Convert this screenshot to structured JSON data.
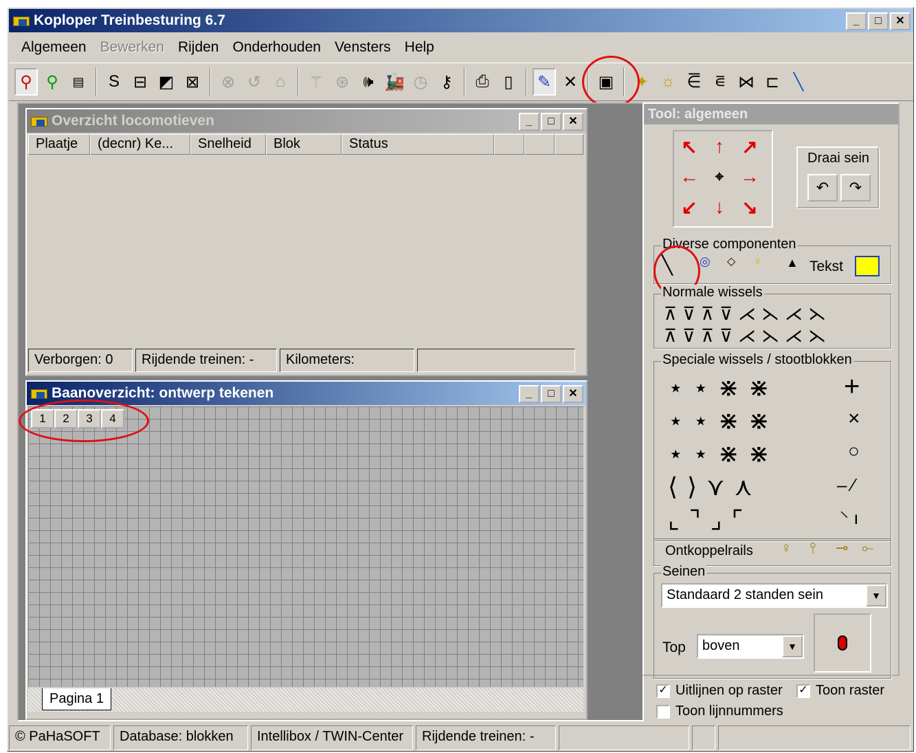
{
  "app": {
    "title": "Koploper Treinbesturing 6.7"
  },
  "menu": [
    {
      "label": "Algemeen",
      "disabled": false
    },
    {
      "label": "Bewerken",
      "disabled": true
    },
    {
      "label": "Rijden",
      "disabled": false
    },
    {
      "label": "Onderhouden",
      "disabled": false
    },
    {
      "label": "Vensters",
      "disabled": false
    },
    {
      "label": "Help",
      "disabled": false
    }
  ],
  "loco_window": {
    "title": "Overzicht locomotieven",
    "columns": [
      "Plaatje",
      "(decnr) Ke...",
      "Snelheid",
      "Blok",
      "Status",
      "",
      "",
      ""
    ],
    "status": {
      "hidden": "Verborgen: 0",
      "running": "Rijdende treinen: -",
      "km": "Kilometers:"
    }
  },
  "track_window": {
    "title": "Baanoverzicht: ontwerp tekenen",
    "pages": [
      "1",
      "2",
      "3",
      "4"
    ],
    "tab": "Pagina 1"
  },
  "tool_panel": {
    "title": "Tool: algemeen",
    "rotate_label": "Draai sein",
    "rotate_left": "↶",
    "rotate_right": "↷",
    "misc_label": "Diverse componenten",
    "text_label": "Tekst",
    "normal_switches_label": "Normale wissels",
    "special_switches_label": "Speciale wissels / stootblokken",
    "uncouple_label": "Ontkoppelrails",
    "signals_label": "Seinen",
    "signal_type": "Standaard 2 standen sein",
    "top_label": "Top",
    "top_value": "boven",
    "align_grid": "Uitlijnen op raster",
    "show_grid": "Toon raster",
    "show_line_numbers": "Toon lijnnummers",
    "text_color": "#ffff00"
  },
  "statusbar": [
    "© PaHaSOFT",
    "Database: blokken",
    "Intellibox / TWIN-Center",
    "Rijdende treinen: -",
    "",
    "",
    ""
  ],
  "colors": {
    "title_active": "#0a246a",
    "highlight_circle": "#e01010"
  }
}
